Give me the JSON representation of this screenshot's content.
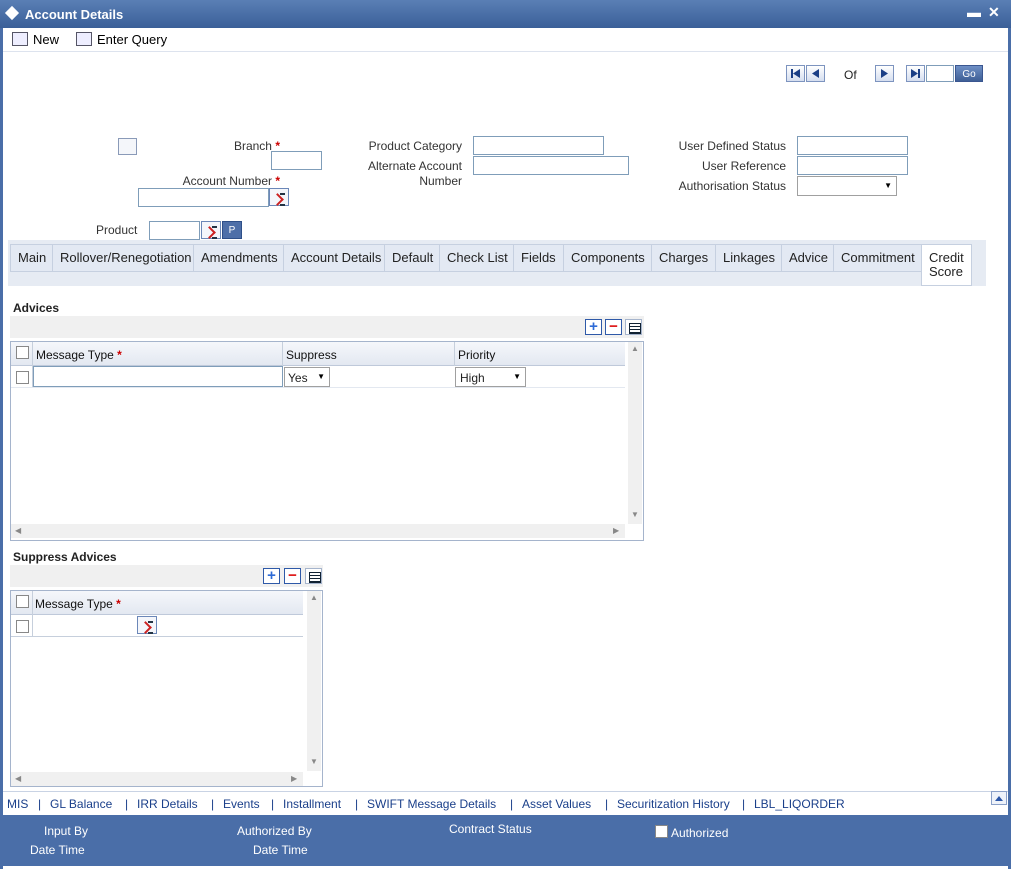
{
  "window": {
    "title": "Account Details",
    "minimize": "▬",
    "close": "✕"
  },
  "toolbar": {
    "new_label": "New",
    "enter_query_label": "Enter Query"
  },
  "navigation": {
    "of_label": "Of",
    "go_label": "Go",
    "record_value": ""
  },
  "header": {
    "branch_label": "Branch",
    "account_number_label": "Account Number",
    "product_label": "Product",
    "product_button": "P",
    "product_category_label": "Product Category",
    "alternate_account_label_1": "Alternate Account",
    "alternate_account_label_2": "Number",
    "user_defined_status_label": "User Defined Status",
    "user_reference_label": "User Reference",
    "authorisation_status_label": "Authorisation Status",
    "required_mark": "*"
  },
  "tabs": [
    {
      "label": "Main"
    },
    {
      "label": "Rollover/Renegotiation"
    },
    {
      "label": "Amendments"
    },
    {
      "label": "Account Details"
    },
    {
      "label": "Default"
    },
    {
      "label": "Check List"
    },
    {
      "label": "Fields"
    },
    {
      "label": "Components"
    },
    {
      "label": "Charges"
    },
    {
      "label": "Linkages"
    },
    {
      "label": "Advice"
    },
    {
      "label": "Commitment"
    },
    {
      "label": "Credit Score",
      "line1": "Credit",
      "line2": "Score",
      "active": true
    }
  ],
  "advices": {
    "title": "Advices",
    "columns": {
      "message_type": "Message Type",
      "suppress": "Suppress",
      "priority": "Priority"
    },
    "rows": [
      {
        "message_type": "",
        "suppress": "Yes",
        "priority": "High"
      }
    ]
  },
  "suppress_advices": {
    "title": "Suppress Advices",
    "columns": {
      "message_type": "Message Type"
    },
    "rows": [
      {
        "message_type": ""
      }
    ]
  },
  "bottom_links": [
    "MIS",
    "GL Balance",
    "IRR Details",
    "Events",
    "Installment",
    "SWIFT Message Details",
    "Asset Values",
    "Securitization History",
    "LBL_LIQORDER"
  ],
  "footer": {
    "input_by": "Input By",
    "date_time_1": "Date Time",
    "authorized_by": "Authorized By",
    "date_time_2": "Date Time",
    "contract_status": "Contract Status",
    "authorized": "Authorized"
  }
}
